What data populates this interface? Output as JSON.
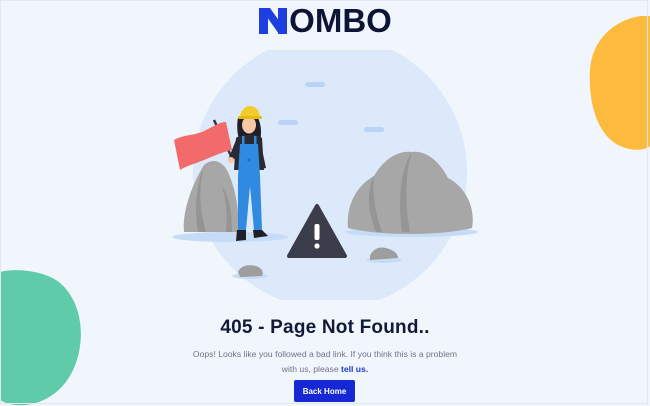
{
  "header": {
    "logo_text": "OMBO",
    "logo_mark_icon": "n-brand-mark",
    "logo_mark_color": "#1d3fe0"
  },
  "main": {
    "title": "405 - Page Not Found..",
    "description_line1": "Oops! Looks like you followed a bad link. If you think this is a problem",
    "description_line2": "with us, please",
    "link_label": "tell us.",
    "button_label": "Back Home"
  },
  "illustration": {
    "icons": [
      "worker-figure",
      "red-flag",
      "rock",
      "warning-sign-icon",
      "cloud"
    ]
  },
  "colors": {
    "background": "#f1f6fd",
    "primary": "#1628d3",
    "blob_yellow": "#fdbb3d",
    "blob_green": "#5fcba8",
    "circle": "#dce9fb",
    "flag": "#f26a6a",
    "rock": "#a7a7a7",
    "sign": "#3c3d4b"
  }
}
